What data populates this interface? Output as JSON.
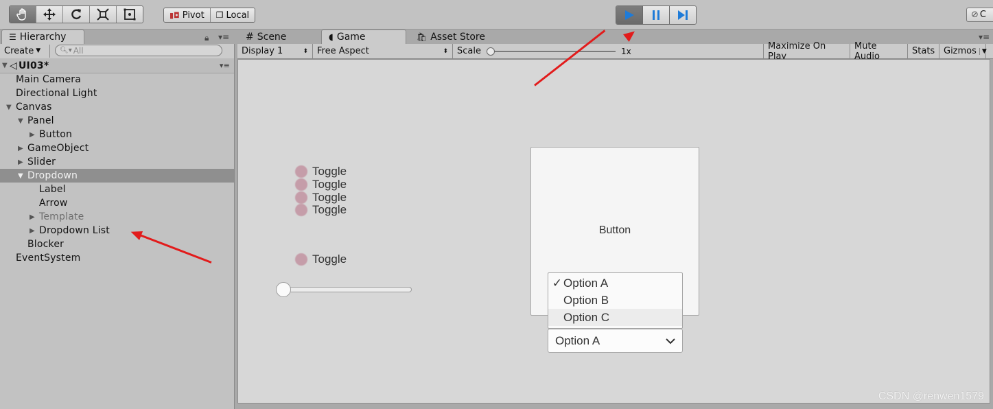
{
  "toolbar": {
    "tools": [
      "hand-tool",
      "move-tool",
      "rotate-tool",
      "scale-tool",
      "rect-tool"
    ],
    "pivot_label": "Pivot",
    "local_label": "Local",
    "right_stub": "C"
  },
  "tabs": {
    "hierarchy": "Hierarchy",
    "scene": "Scene",
    "game": "Game",
    "asset_store": "Asset Store"
  },
  "hierarchy": {
    "create_label": "Create",
    "search_placeholder": "All",
    "scene_name": "UI03*",
    "items": [
      {
        "label": "Main Camera",
        "indent": 1,
        "arrow": "",
        "state": ""
      },
      {
        "label": "Directional Light",
        "indent": 1,
        "arrow": "",
        "state": ""
      },
      {
        "label": "Canvas",
        "indent": 1,
        "arrow": "▼",
        "state": ""
      },
      {
        "label": "Panel",
        "indent": 2,
        "arrow": "▼",
        "state": ""
      },
      {
        "label": "Button",
        "indent": 3,
        "arrow": "▶",
        "state": ""
      },
      {
        "label": "GameObject",
        "indent": 2,
        "arrow": "▶",
        "state": ""
      },
      {
        "label": "Slider",
        "indent": 2,
        "arrow": "▶",
        "state": ""
      },
      {
        "label": "Dropdown",
        "indent": 2,
        "arrow": "▼",
        "state": "selected"
      },
      {
        "label": "Label",
        "indent": 3,
        "arrow": "",
        "state": ""
      },
      {
        "label": "Arrow",
        "indent": 3,
        "arrow": "",
        "state": ""
      },
      {
        "label": "Template",
        "indent": 3,
        "arrow": "▶",
        "state": "inactive"
      },
      {
        "label": "Dropdown List",
        "indent": 3,
        "arrow": "▶",
        "state": ""
      },
      {
        "label": "Blocker",
        "indent": 2,
        "arrow": "",
        "state": ""
      },
      {
        "label": "EventSystem",
        "indent": 1,
        "arrow": "",
        "state": ""
      }
    ]
  },
  "gamebar": {
    "display": "Display 1",
    "aspect": "Free Aspect",
    "scale_label": "Scale",
    "scale_value": "1x",
    "maximize": "Maximize On Play",
    "mute": "Mute Audio",
    "stats": "Stats",
    "gizmos": "Gizmos"
  },
  "game": {
    "toggles": [
      "Toggle",
      "Toggle",
      "Toggle",
      "Toggle",
      "Toggle"
    ],
    "button_label": "Button",
    "dropdown_options": [
      {
        "label": "Option A",
        "checked": "✓"
      },
      {
        "label": "Option B",
        "checked": ""
      },
      {
        "label": "Option C",
        "checked": ""
      }
    ],
    "dropdown_value": "Option A"
  },
  "colors": {
    "annotation_arrow": "#e21b1b",
    "play_accent": "#1e7bd8",
    "toggle": "#c08a9a"
  },
  "watermark": "CSDN @renwen1579"
}
